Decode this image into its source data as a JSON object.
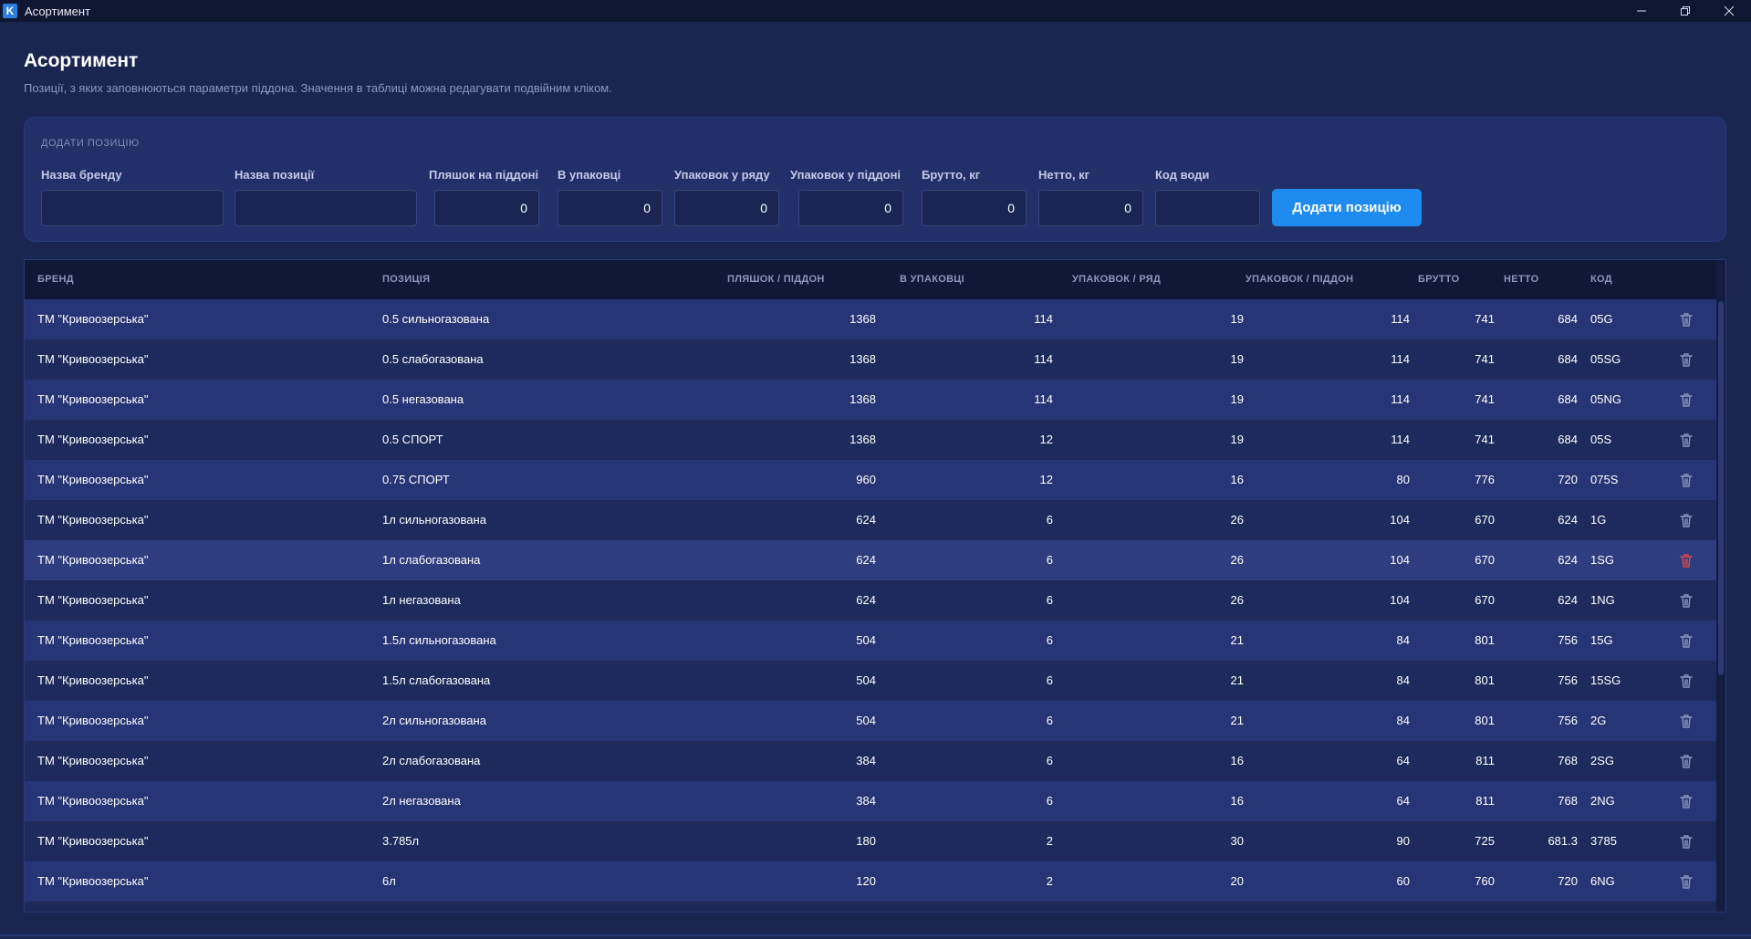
{
  "window": {
    "title": "Асортимент",
    "app_icon_letter": "K"
  },
  "header": {
    "title": "Асортимент",
    "subtitle": "Позиції, з яких заповнюються параметри піддона. Значення в таблиці можна редагувати подвійним кліком."
  },
  "add_panel": {
    "caption": "ДОДАТИ ПОЗИЦІЮ",
    "fields": {
      "brand": {
        "label": "Назва бренду",
        "value": ""
      },
      "position": {
        "label": "Назва позиції",
        "value": ""
      },
      "bottles_per_pallet": {
        "label": "Пляшок на піддоні",
        "value": "0"
      },
      "in_pack": {
        "label": "В упаковці",
        "value": "0"
      },
      "packs_per_row": {
        "label": "Упаковок у ряду",
        "value": "0"
      },
      "packs_per_pallet": {
        "label": "Упаковок у піддоні",
        "value": "0"
      },
      "gross": {
        "label": "Брутто, кг",
        "value": "0"
      },
      "net": {
        "label": "Нетто, кг",
        "value": "0"
      },
      "water_code": {
        "label": "Код води",
        "value": ""
      }
    },
    "add_button_label": "Додати позицію"
  },
  "table": {
    "columns": [
      "БРЕНД",
      "ПОЗИЦІЯ",
      "ПЛЯШОК / ПІДДОН",
      "В УПАКОВЦІ",
      "УПАКОВОК / РЯД",
      "УПАКОВОК / ПІДДОН",
      "БРУТТО",
      "НЕТТО",
      "КОД"
    ],
    "rows": [
      [
        "ТМ \"Кривоозерська\"",
        "0.5 сильногазована",
        "1368",
        "114",
        "19",
        "114",
        "741",
        "684",
        "05G"
      ],
      [
        "ТМ \"Кривоозерська\"",
        "0.5 слабогазована",
        "1368",
        "114",
        "19",
        "114",
        "741",
        "684",
        "05SG"
      ],
      [
        "ТМ \"Кривоозерська\"",
        "0.5 негазована",
        "1368",
        "114",
        "19",
        "114",
        "741",
        "684",
        "05NG"
      ],
      [
        "ТМ \"Кривоозерська\"",
        "0.5 СПОРТ",
        "1368",
        "12",
        "19",
        "114",
        "741",
        "684",
        "05S"
      ],
      [
        "ТМ \"Кривоозерська\"",
        "0.75 СПОРТ",
        "960",
        "12",
        "16",
        "80",
        "776",
        "720",
        "075S"
      ],
      [
        "ТМ \"Кривоозерська\"",
        "1л сильногазована",
        "624",
        "6",
        "26",
        "104",
        "670",
        "624",
        "1G"
      ],
      [
        "ТМ \"Кривоозерська\"",
        "1л слабогазована",
        "624",
        "6",
        "26",
        "104",
        "670",
        "624",
        "1SG"
      ],
      [
        "ТМ \"Кривоозерська\"",
        "1л негазована",
        "624",
        "6",
        "26",
        "104",
        "670",
        "624",
        "1NG"
      ],
      [
        "ТМ \"Кривоозерська\"",
        "1.5л сильногазована",
        "504",
        "6",
        "21",
        "84",
        "801",
        "756",
        "15G"
      ],
      [
        "ТМ \"Кривоозерська\"",
        "1.5л слабогазована",
        "504",
        "6",
        "21",
        "84",
        "801",
        "756",
        "15SG"
      ],
      [
        "ТМ \"Кривоозерська\"",
        "2л сильногазована",
        "504",
        "6",
        "21",
        "84",
        "801",
        "756",
        "2G"
      ],
      [
        "ТМ \"Кривоозерська\"",
        "2л слабогазована",
        "384",
        "6",
        "16",
        "64",
        "811",
        "768",
        "2SG"
      ],
      [
        "ТМ \"Кривоозерська\"",
        "2л негазована",
        "384",
        "6",
        "16",
        "64",
        "811",
        "768",
        "2NG"
      ],
      [
        "ТМ \"Кривоозерська\"",
        "3.785л",
        "180",
        "2",
        "30",
        "90",
        "725",
        "681.3",
        "3785"
      ],
      [
        "ТМ \"Кривоозерська\"",
        "6л",
        "120",
        "2",
        "20",
        "60",
        "760",
        "720",
        "6NG"
      ]
    ],
    "hovered_row_index": 6
  },
  "colors": {
    "accent": "#1e8bf0",
    "background": "#1a2550",
    "delete_icon": "#8a96be",
    "delete_icon_hover": "#e04848"
  },
  "icons": {
    "row_action": "trash-icon",
    "minimize": "minimize-icon",
    "maximize": "restore-icon",
    "close": "close-icon"
  }
}
